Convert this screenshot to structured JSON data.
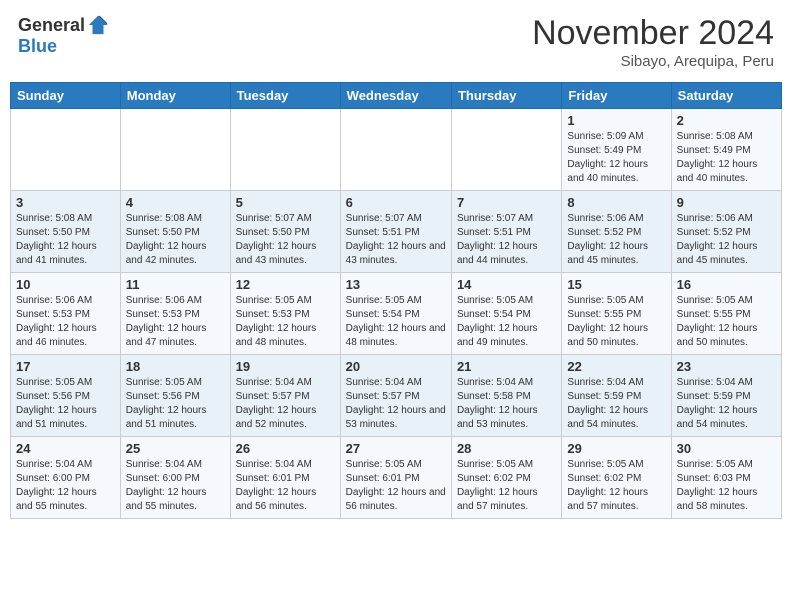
{
  "header": {
    "logo": {
      "general": "General",
      "blue": "Blue"
    },
    "title": "November 2024",
    "location": "Sibayo, Arequipa, Peru"
  },
  "weekdays": [
    "Sunday",
    "Monday",
    "Tuesday",
    "Wednesday",
    "Thursday",
    "Friday",
    "Saturday"
  ],
  "weeks": [
    [
      {
        "day": "",
        "info": ""
      },
      {
        "day": "",
        "info": ""
      },
      {
        "day": "",
        "info": ""
      },
      {
        "day": "",
        "info": ""
      },
      {
        "day": "",
        "info": ""
      },
      {
        "day": "1",
        "info": "Sunrise: 5:09 AM\nSunset: 5:49 PM\nDaylight: 12 hours and 40 minutes."
      },
      {
        "day": "2",
        "info": "Sunrise: 5:08 AM\nSunset: 5:49 PM\nDaylight: 12 hours and 40 minutes."
      }
    ],
    [
      {
        "day": "3",
        "info": "Sunrise: 5:08 AM\nSunset: 5:50 PM\nDaylight: 12 hours and 41 minutes."
      },
      {
        "day": "4",
        "info": "Sunrise: 5:08 AM\nSunset: 5:50 PM\nDaylight: 12 hours and 42 minutes."
      },
      {
        "day": "5",
        "info": "Sunrise: 5:07 AM\nSunset: 5:50 PM\nDaylight: 12 hours and 43 minutes."
      },
      {
        "day": "6",
        "info": "Sunrise: 5:07 AM\nSunset: 5:51 PM\nDaylight: 12 hours and 43 minutes."
      },
      {
        "day": "7",
        "info": "Sunrise: 5:07 AM\nSunset: 5:51 PM\nDaylight: 12 hours and 44 minutes."
      },
      {
        "day": "8",
        "info": "Sunrise: 5:06 AM\nSunset: 5:52 PM\nDaylight: 12 hours and 45 minutes."
      },
      {
        "day": "9",
        "info": "Sunrise: 5:06 AM\nSunset: 5:52 PM\nDaylight: 12 hours and 45 minutes."
      }
    ],
    [
      {
        "day": "10",
        "info": "Sunrise: 5:06 AM\nSunset: 5:53 PM\nDaylight: 12 hours and 46 minutes."
      },
      {
        "day": "11",
        "info": "Sunrise: 5:06 AM\nSunset: 5:53 PM\nDaylight: 12 hours and 47 minutes."
      },
      {
        "day": "12",
        "info": "Sunrise: 5:05 AM\nSunset: 5:53 PM\nDaylight: 12 hours and 48 minutes."
      },
      {
        "day": "13",
        "info": "Sunrise: 5:05 AM\nSunset: 5:54 PM\nDaylight: 12 hours and 48 minutes."
      },
      {
        "day": "14",
        "info": "Sunrise: 5:05 AM\nSunset: 5:54 PM\nDaylight: 12 hours and 49 minutes."
      },
      {
        "day": "15",
        "info": "Sunrise: 5:05 AM\nSunset: 5:55 PM\nDaylight: 12 hours and 50 minutes."
      },
      {
        "day": "16",
        "info": "Sunrise: 5:05 AM\nSunset: 5:55 PM\nDaylight: 12 hours and 50 minutes."
      }
    ],
    [
      {
        "day": "17",
        "info": "Sunrise: 5:05 AM\nSunset: 5:56 PM\nDaylight: 12 hours and 51 minutes."
      },
      {
        "day": "18",
        "info": "Sunrise: 5:05 AM\nSunset: 5:56 PM\nDaylight: 12 hours and 51 minutes."
      },
      {
        "day": "19",
        "info": "Sunrise: 5:04 AM\nSunset: 5:57 PM\nDaylight: 12 hours and 52 minutes."
      },
      {
        "day": "20",
        "info": "Sunrise: 5:04 AM\nSunset: 5:57 PM\nDaylight: 12 hours and 53 minutes."
      },
      {
        "day": "21",
        "info": "Sunrise: 5:04 AM\nSunset: 5:58 PM\nDaylight: 12 hours and 53 minutes."
      },
      {
        "day": "22",
        "info": "Sunrise: 5:04 AM\nSunset: 5:59 PM\nDaylight: 12 hours and 54 minutes."
      },
      {
        "day": "23",
        "info": "Sunrise: 5:04 AM\nSunset: 5:59 PM\nDaylight: 12 hours and 54 minutes."
      }
    ],
    [
      {
        "day": "24",
        "info": "Sunrise: 5:04 AM\nSunset: 6:00 PM\nDaylight: 12 hours and 55 minutes."
      },
      {
        "day": "25",
        "info": "Sunrise: 5:04 AM\nSunset: 6:00 PM\nDaylight: 12 hours and 55 minutes."
      },
      {
        "day": "26",
        "info": "Sunrise: 5:04 AM\nSunset: 6:01 PM\nDaylight: 12 hours and 56 minutes."
      },
      {
        "day": "27",
        "info": "Sunrise: 5:05 AM\nSunset: 6:01 PM\nDaylight: 12 hours and 56 minutes."
      },
      {
        "day": "28",
        "info": "Sunrise: 5:05 AM\nSunset: 6:02 PM\nDaylight: 12 hours and 57 minutes."
      },
      {
        "day": "29",
        "info": "Sunrise: 5:05 AM\nSunset: 6:02 PM\nDaylight: 12 hours and 57 minutes."
      },
      {
        "day": "30",
        "info": "Sunrise: 5:05 AM\nSunset: 6:03 PM\nDaylight: 12 hours and 58 minutes."
      }
    ]
  ]
}
